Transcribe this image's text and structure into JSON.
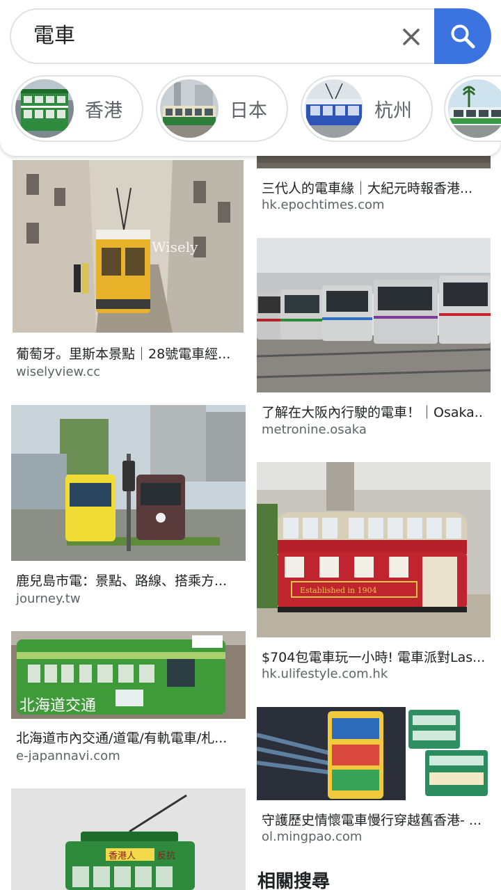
{
  "search": {
    "query": "電車"
  },
  "chips": [
    {
      "label": "香港",
      "thumb": "green-double-decker-tram"
    },
    {
      "label": "日本",
      "thumb": "green-cream-tram"
    },
    {
      "label": "杭州",
      "thumb": "blue-trolley-bus"
    },
    {
      "label": "",
      "thumb": "green-tram-palms"
    }
  ],
  "results_left": [
    {
      "title": "葡萄牙。里斯本景點｜28號電車經...",
      "source": "wiselyview.cc",
      "watermark": "Wisely"
    },
    {
      "title": "鹿兒島市電：景點、路線、搭乘方...",
      "source": "journey.tw"
    },
    {
      "title": "北海道市內交通/道電/有軌電車/札...",
      "source": "e-japannavi.com",
      "overlay": "北海道交通"
    },
    {
      "title": "",
      "source": "",
      "sign": "香港人",
      "sign2": "反抗"
    }
  ],
  "results_right": [
    {
      "title": "三代人的電車緣｜大紀元時報香港...",
      "source": "hk.epochtimes.com"
    },
    {
      "title": "了解在大阪內行駛的電車！｜Osaka...",
      "source": "metronine.osaka"
    },
    {
      "title": "$704包電車玩一小時! 電車派對Las...",
      "source": "hk.ulifestyle.com.hk",
      "plate": "Established in 1904"
    },
    {
      "title": "守護歷史情懷電車慢行穿越舊香港- ...",
      "source": "ol.mingpao.com"
    }
  ],
  "related_label": "相關搜尋",
  "colors": {
    "accent": "#3b74e1",
    "tram_green": "#2e8b3e",
    "tram_yellow": "#e8b32a",
    "tram_red": "#b5202a"
  }
}
